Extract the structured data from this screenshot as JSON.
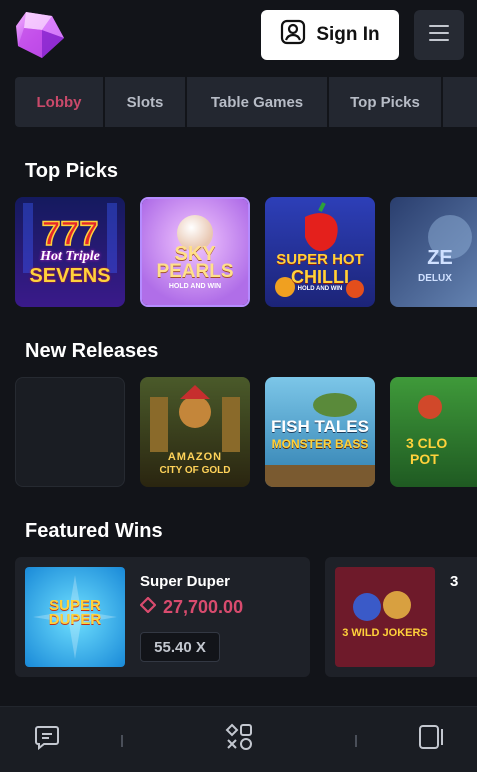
{
  "header": {
    "signin_label": "Sign In",
    "logo_icon": "gem-logo",
    "menu_icon": "hamburger-icon"
  },
  "tabs": [
    {
      "label": "Lobby",
      "active": true
    },
    {
      "label": "Slots",
      "active": false
    },
    {
      "label": "Table Games",
      "active": false
    },
    {
      "label": "Top Picks",
      "active": false
    }
  ],
  "sections": {
    "top_picks": "Top Picks",
    "new_releases": "New Releases",
    "featured_wins": "Featured Wins"
  },
  "top_picks": [
    {
      "line1": "Hot Triple",
      "line2": "SEVENS",
      "line3": ""
    },
    {
      "line1": "SKY",
      "line2": "PEARLS",
      "line3": "HOLD AND WIN"
    },
    {
      "line1": "SUPER HOT",
      "line2": "CHILLI",
      "line3": "HOLD AND WIN"
    },
    {
      "line1": "ZE",
      "line2": "DELUX",
      "line3": ""
    }
  ],
  "new_releases": [
    {
      "line1": "",
      "line2": "",
      "line3": ""
    },
    {
      "line1": "AMAZON",
      "line2": "CITY OF GOLD",
      "line3": ""
    },
    {
      "line1": "FISH TALES",
      "line2": "MONSTER BASS",
      "line3": ""
    },
    {
      "line1": "3 CLO",
      "line2": "POT",
      "line3": ""
    }
  ],
  "featured_wins": [
    {
      "game": "Super Duper",
      "amount": "27,700.00",
      "multiplier": "55.40 X",
      "thumb_text": "SUPER DUPER"
    },
    {
      "game": "3",
      "amount": "",
      "multiplier": "",
      "thumb_text": "3 WILD JOKERS"
    }
  ],
  "colors": {
    "accent": "#d94b6e",
    "background": "#121419",
    "card": "#232730"
  },
  "bottom_nav": [
    {
      "icon": "chat-icon"
    },
    {
      "icon": "games-grid-icon"
    },
    {
      "icon": "betslip-icon"
    }
  ]
}
